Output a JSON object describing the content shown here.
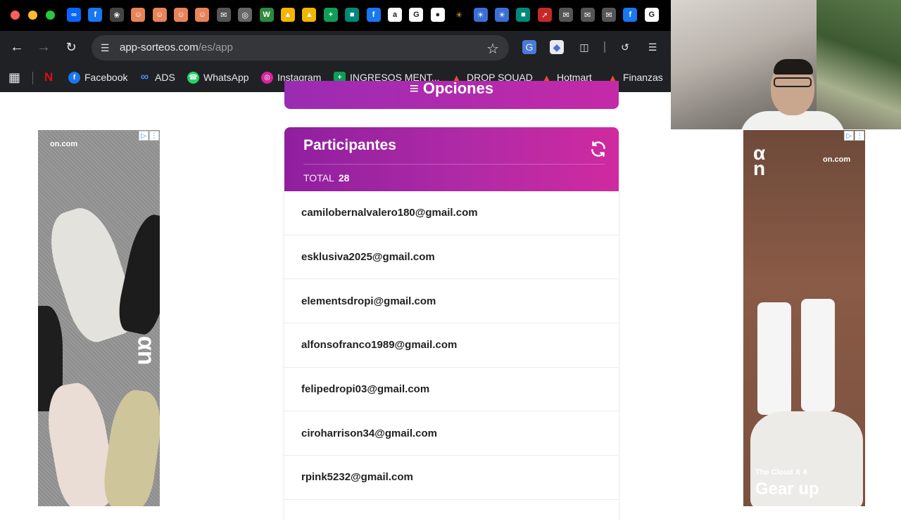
{
  "browser": {
    "url_host": "app-sorteos.com",
    "url_path": "/es/app",
    "tab_icons": [
      "meta-icon",
      "facebook-icon",
      "openai-icon",
      "emoji-icon",
      "emoji-icon",
      "emoji-icon",
      "emoji-icon",
      "chat-icon",
      "chrome-icon",
      "w-icon",
      "drive-icon",
      "drive-icon",
      "sheets-icon",
      "meet-icon",
      "facebook-icon",
      "amazon-icon",
      "google-icon",
      "apple-icon",
      "walmart-icon",
      "sunrise-icon",
      "sunrise-icon",
      "meet-icon",
      "arrow-icon",
      "chat-icon",
      "chat-icon",
      "chat-icon",
      "facebook-icon",
      "google-icon"
    ]
  },
  "bookmarks": [
    {
      "label": "Facebook",
      "icon": "facebook-icon"
    },
    {
      "label": "ADS",
      "icon": "meta-icon"
    },
    {
      "label": "WhatsApp",
      "icon": "whatsapp-icon"
    },
    {
      "label": "Instagram",
      "icon": "instagram-icon"
    },
    {
      "label": "INGRESOS MENT...",
      "icon": "sheets-icon"
    },
    {
      "label": "DROP SQUAD",
      "icon": "flame-icon"
    },
    {
      "label": "Hotmart",
      "icon": "flame-icon"
    },
    {
      "label": "Finanzas",
      "icon": "flame-icon"
    }
  ],
  "options": {
    "label": "Opciones"
  },
  "participants": {
    "title": "Participantes",
    "total_label": "TOTAL",
    "total": "28",
    "list": [
      "camilobernalvalero180@gmail.com",
      "esklusiva2025@gmail.com",
      "elementsdropi@gmail.com",
      "alfonsofranco1989@gmail.com",
      "felipedropi03@gmail.com",
      "ciroharrison34@gmail.com",
      "rpink5232@gmail.com"
    ]
  },
  "ads": {
    "left_brand": "on.com",
    "right_brand": "on.com",
    "right_caption_small": "The Cloud X 4",
    "right_caption_large": "Gear up"
  },
  "colors": {
    "accent_start": "#8f1f9f",
    "accent_end": "#d02aa0"
  }
}
